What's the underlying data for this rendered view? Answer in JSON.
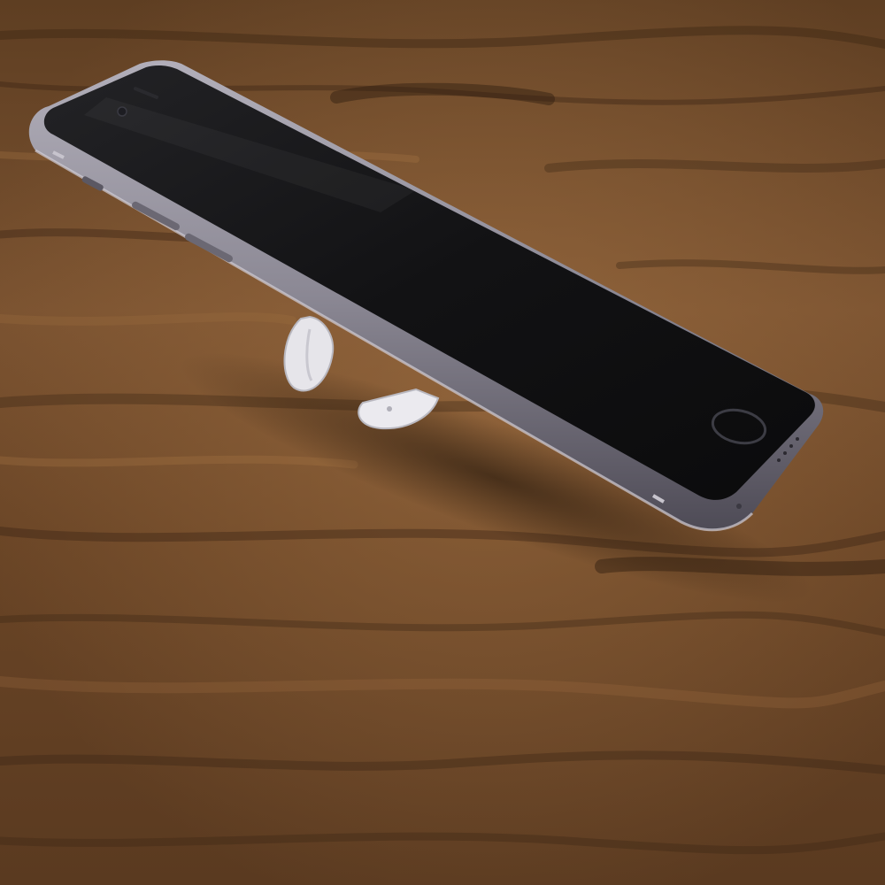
{
  "scene": {
    "subject": "smartphone",
    "accessory": "phone-stand",
    "surface": "wooden-table"
  },
  "colors": {
    "wood_base": "#6b4727",
    "wood_light": "#9a6a3e",
    "wood_dark": "#3a2414",
    "phone_frame": "#8f8c98",
    "phone_frame_shadow": "#4d4a55",
    "phone_screen": "#141416",
    "stand": "#e9e8ec"
  }
}
